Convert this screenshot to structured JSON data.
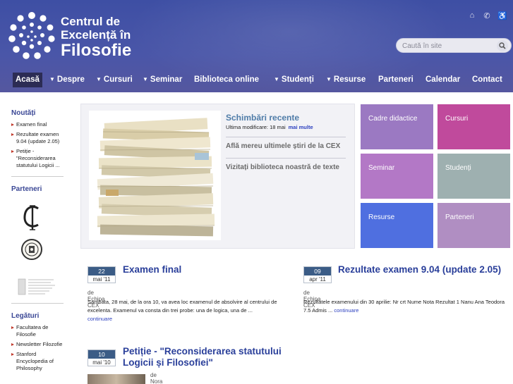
{
  "site": {
    "name_line1": "Centrul de",
    "name_line2": "Excelență în",
    "name_line3": "Filosofie"
  },
  "header": {
    "icons": [
      "home-icon",
      "contact-icon",
      "accessibility-icon"
    ],
    "search": {
      "placeholder": "Caută în site"
    }
  },
  "nav": [
    {
      "label": "Acasă",
      "active": true,
      "dropdown": false
    },
    {
      "label": "Despre",
      "dropdown": true
    },
    {
      "label": "Cursuri",
      "dropdown": true
    },
    {
      "label": "Seminar",
      "dropdown": true
    },
    {
      "label": "Biblioteca online",
      "dropdown": false
    },
    {
      "label": "Studenți",
      "dropdown": true
    },
    {
      "label": "Resurse",
      "dropdown": true
    },
    {
      "label": "Parteneri",
      "dropdown": false
    },
    {
      "label": "Calendar",
      "dropdown": false
    },
    {
      "label": "Contact",
      "dropdown": false
    }
  ],
  "sidebar": {
    "news_title": "Noutăți",
    "news": [
      "Examen final",
      "Rezultate examen 9.04 (update 2.05)",
      "Petiție - \"Reconsiderarea statutului Logicii ..."
    ],
    "partners_title": "Parteneri",
    "partners": [
      "partner-logo-c",
      "partner-logo-colegiul-national",
      "partner-logo-ministerul"
    ],
    "links_title": "Legături",
    "links": [
      "Facultatea de Filosofie",
      "Newsletter Filozofie",
      "Stanford Encyclopedia of Philosophy"
    ]
  },
  "featured": {
    "title": "Schimbări recente",
    "meta_label": "Ultima modificare: 18 mai",
    "meta_link": "mai multe",
    "link1": "Află mereu ultimele știri de la CEX",
    "link2": "Vizitați biblioteca noastră de texte"
  },
  "tiles": [
    {
      "label": "Cadre didactice",
      "color": "#9b79c2"
    },
    {
      "label": "Cursuri",
      "color": "#c04a9c"
    },
    {
      "label": "Seminar",
      "color": "#b378c6"
    },
    {
      "label": "Studenți",
      "color": "#9eb0b0"
    },
    {
      "label": "Resurse",
      "color": "#4f6fe0"
    },
    {
      "label": "Parteneri",
      "color": "#b08ec2"
    }
  ],
  "articles": [
    {
      "day": "22",
      "month": "mai '11",
      "title": "Examen final",
      "by": "de Echipa CEX",
      "body": "Sambata, 28 mai, de la ora 10, va avea loc examenul de absolvire al centrului de excelenta. Examenul va consta din trei probe: una de logica, una de ...",
      "more": "continuare"
    },
    {
      "day": "09",
      "month": "apr '11",
      "title": "Rezultate examen 9.04 (update 2.05)",
      "by": "de Echipa CEX",
      "body": "Rezultatele examenului din 30 aprilie: Nr crt Nume Nota Rezultat 1 Nanu Ana Teodora 7.5 Admis ...",
      "more": "continuare"
    },
    {
      "day": "10",
      "month": "mai '10",
      "title": "Petiție - \"Reconsiderarea statutului Logicii și Filosofiei\"",
      "by": "de Nora Grigore"
    }
  ],
  "colors": {
    "header": "#4652a6",
    "nav_active": "#2c2c54",
    "accent_link": "#2b3fbf",
    "sidebar_title": "#3a4795",
    "date_badge": "#3b5c86"
  }
}
